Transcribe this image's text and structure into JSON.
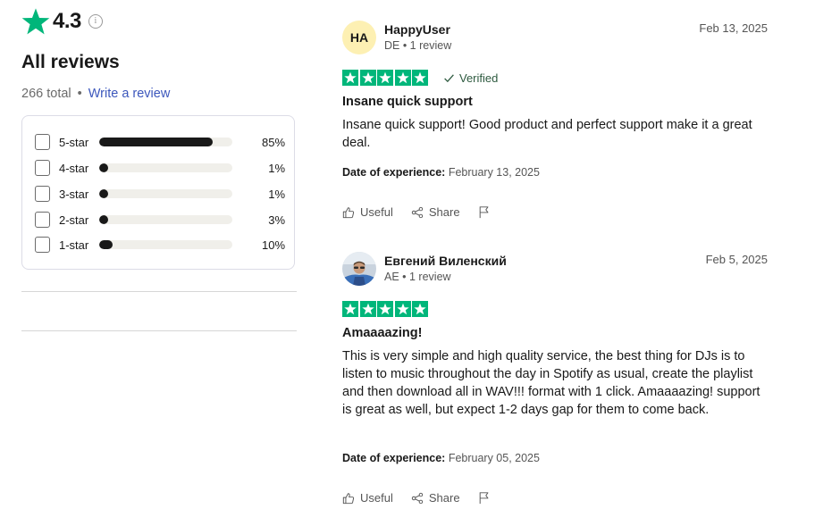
{
  "summary": {
    "rating": "4.3",
    "heading": "All reviews",
    "total": "266 total",
    "write_review": "Write a review",
    "distribution": [
      {
        "label": "5-star",
        "percent_text": "85%",
        "fraction": 0.85
      },
      {
        "label": "4-star",
        "percent_text": "1%",
        "fraction": 0.01
      },
      {
        "label": "3-star",
        "percent_text": "1%",
        "fraction": 0.01
      },
      {
        "label": "2-star",
        "percent_text": "3%",
        "fraction": 0.03
      },
      {
        "label": "1-star",
        "percent_text": "10%",
        "fraction": 0.1
      }
    ]
  },
  "reviews": [
    {
      "initials": "HA",
      "name": "HappyUser",
      "meta": "DE • 1 review",
      "date": "Feb 13, 2025",
      "stars": 5,
      "verified": "Verified",
      "title": "Insane quick support",
      "body": "Insane quick support! Good product and perfect support make it a great deal.",
      "experience_label": "Date of experience:",
      "experience_date": "February 13, 2025",
      "useful": "Useful",
      "share": "Share"
    },
    {
      "name": "Евгений Виленский",
      "meta": "AE • 1 review",
      "date": "Feb 5, 2025",
      "stars": 5,
      "title": "Amaaaazing!",
      "body": "This is very simple and high quality service, the best thing for DJs is to listen to music throughout the day in Spotify as usual, create the playlist and then download all in WAV!!! format with 1 click. Amaaaazing! support is great as well, but expect 1-2 days gap for them to come back.",
      "experience_label": "Date of experience:",
      "experience_date": "February 05, 2025",
      "useful": "Useful",
      "share": "Share"
    }
  ],
  "colors": {
    "star_green": "#00b67a",
    "bar_fill": "#191919",
    "bar_track": "#f0efea",
    "link": "#3c57bc",
    "avatar_bg": "#fdf0b3"
  }
}
